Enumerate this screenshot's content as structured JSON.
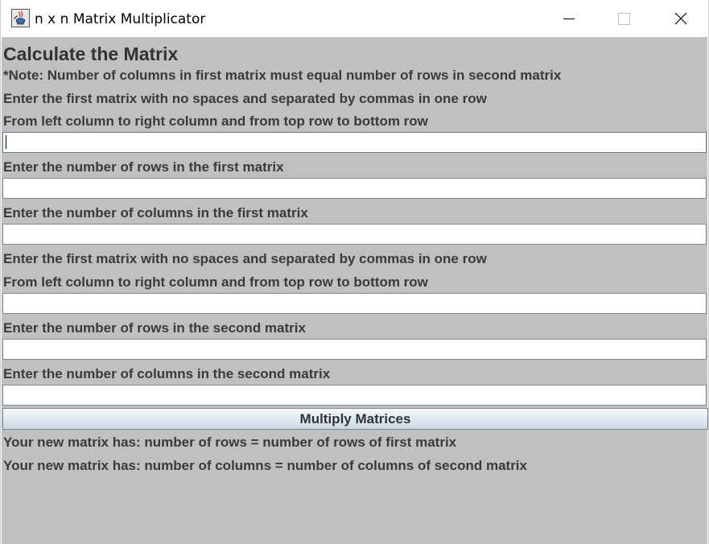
{
  "window": {
    "title": "n x n Matrix Multiplicator",
    "app_icon": "java-cup-icon",
    "controls": {
      "minimize_icon": "minimize-icon",
      "maximize_icon": "maximize-icon",
      "close_icon": "close-icon"
    }
  },
  "main": {
    "heading": "Calculate the Matrix",
    "note": "*Note: Number of columns in first matrix must equal number of rows in second matrix",
    "first_matrix": {
      "instruction_line1": "Enter the first matrix with no spaces and separated by commas in one row",
      "instruction_line2": "From left column to right column and from top row to bottom row",
      "value": "",
      "rows_label": "Enter the number of rows in the first matrix",
      "rows_value": "",
      "cols_label": "Enter the number of columns in the first matrix",
      "cols_value": ""
    },
    "second_matrix": {
      "instruction_line1": "Enter the first matrix with no spaces and separated by commas in one row",
      "instruction_line2": "From left column to right column and from top row to bottom row",
      "value": "",
      "rows_label": "Enter the number of rows in the second matrix",
      "rows_value": "",
      "cols_label": "Enter the number of columns in the second matrix",
      "cols_value": ""
    },
    "multiply_button": "Multiply Matrices",
    "result_rows_text": "Your new matrix has: number of rows = number of rows of first matrix",
    "result_cols_text": "Your new matrix has: number of columns = number of columns of second matrix"
  },
  "colors": {
    "panel_background": "#c0c0c0",
    "label_text": "#3a3a3a",
    "field_border": "#7a8a99",
    "button_gradient_top": "#f4f8fb",
    "button_gradient_bottom": "#c9d8e6"
  }
}
